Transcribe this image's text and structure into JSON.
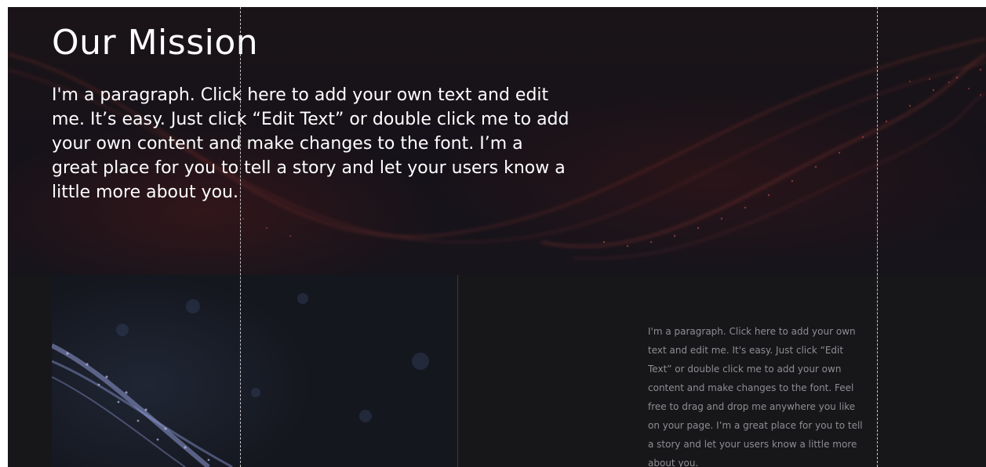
{
  "hero": {
    "title": "Our Mission",
    "paragraph": "I'm a paragraph. Click here to add your own text and edit me. It’s easy. Just click “Edit Text” or double click me to add your own content and make changes to the font. I’m a great place for you to tell a story and let your users know a little more about you."
  },
  "feature": {
    "paragraph": "I'm a paragraph. Click here to add your own text and edit me. It's easy. Just click “Edit Text” or double click me to add your own content and make changes to the font. Feel free to drag and drop me anywhere you like on your page. I’m a great place for you to tell a story and let your users know a little more about you."
  },
  "colors": {
    "background": "#151419",
    "hero_text": "#ffffff",
    "side_text": "#8f8d93",
    "wave_red": "#c2453c",
    "wave_blue": "#8f9bd6"
  }
}
